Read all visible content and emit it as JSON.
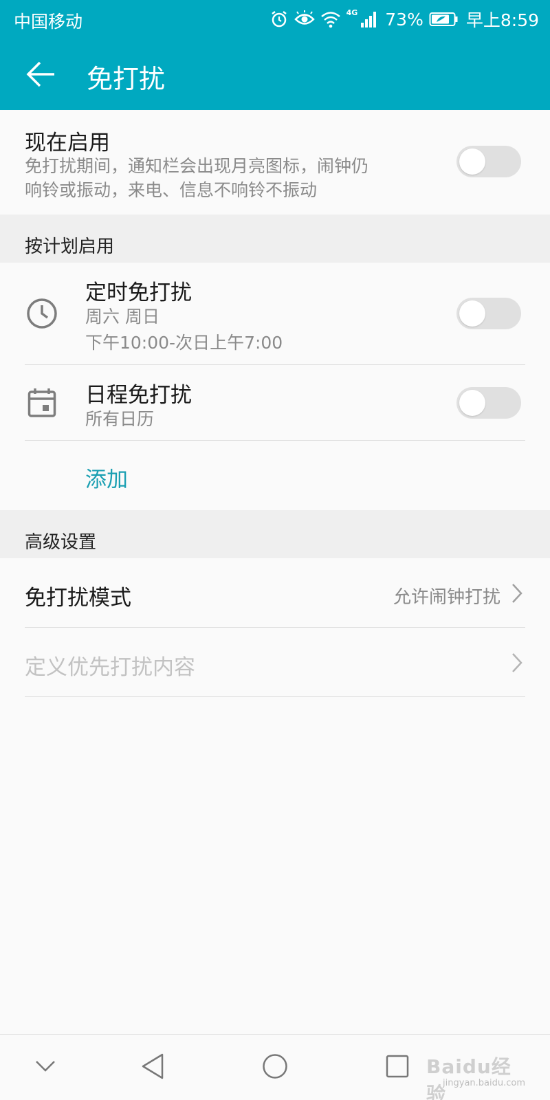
{
  "status_bar": {
    "carrier": "中国移动",
    "network_tag": "4G",
    "battery_percent": "73%",
    "time": "早上8:59",
    "icons": [
      "alarm-icon",
      "eye-comfort-icon",
      "wifi-icon",
      "signal-icon",
      "battery-icon"
    ]
  },
  "app_bar": {
    "title": "免打扰",
    "back_icon": "arrow-left-icon"
  },
  "enable_now": {
    "title": "现在启用",
    "description_line1": "免打扰期间，通知栏会出现月亮图标，闹钟仍",
    "description_line2": "响铃或振动，来电、信息不响铃不振动",
    "toggle_on": false
  },
  "schedule_section": {
    "header": "按计划启用",
    "items": [
      {
        "icon": "clock-icon",
        "title": "定时免打扰",
        "subtitle_line1": "周六 周日",
        "subtitle_line2": "下午10:00-次日上午7:00",
        "toggle_on": false
      },
      {
        "icon": "calendar-icon",
        "title": "日程免打扰",
        "subtitle_line1": "所有日历",
        "toggle_on": false
      }
    ],
    "add_label": "添加"
  },
  "advanced_section": {
    "header": "高级设置",
    "mode_row": {
      "title": "免打扰模式",
      "value": "允许闹钟打扰"
    },
    "priority_row": {
      "title": "定义优先打扰内容",
      "disabled": true
    }
  },
  "nav_bar": {
    "icons": [
      "collapse-chevron-icon",
      "back-triangle-icon",
      "home-circle-icon",
      "recents-square-icon"
    ]
  },
  "watermark": {
    "line1": "Baidu经验",
    "line2": "jingyan.baidu.com"
  },
  "colors": {
    "accent": "#00a9c0",
    "link": "#1a9fb2",
    "toggle_off": "#e0e0e0",
    "section_band": "#efefef"
  }
}
